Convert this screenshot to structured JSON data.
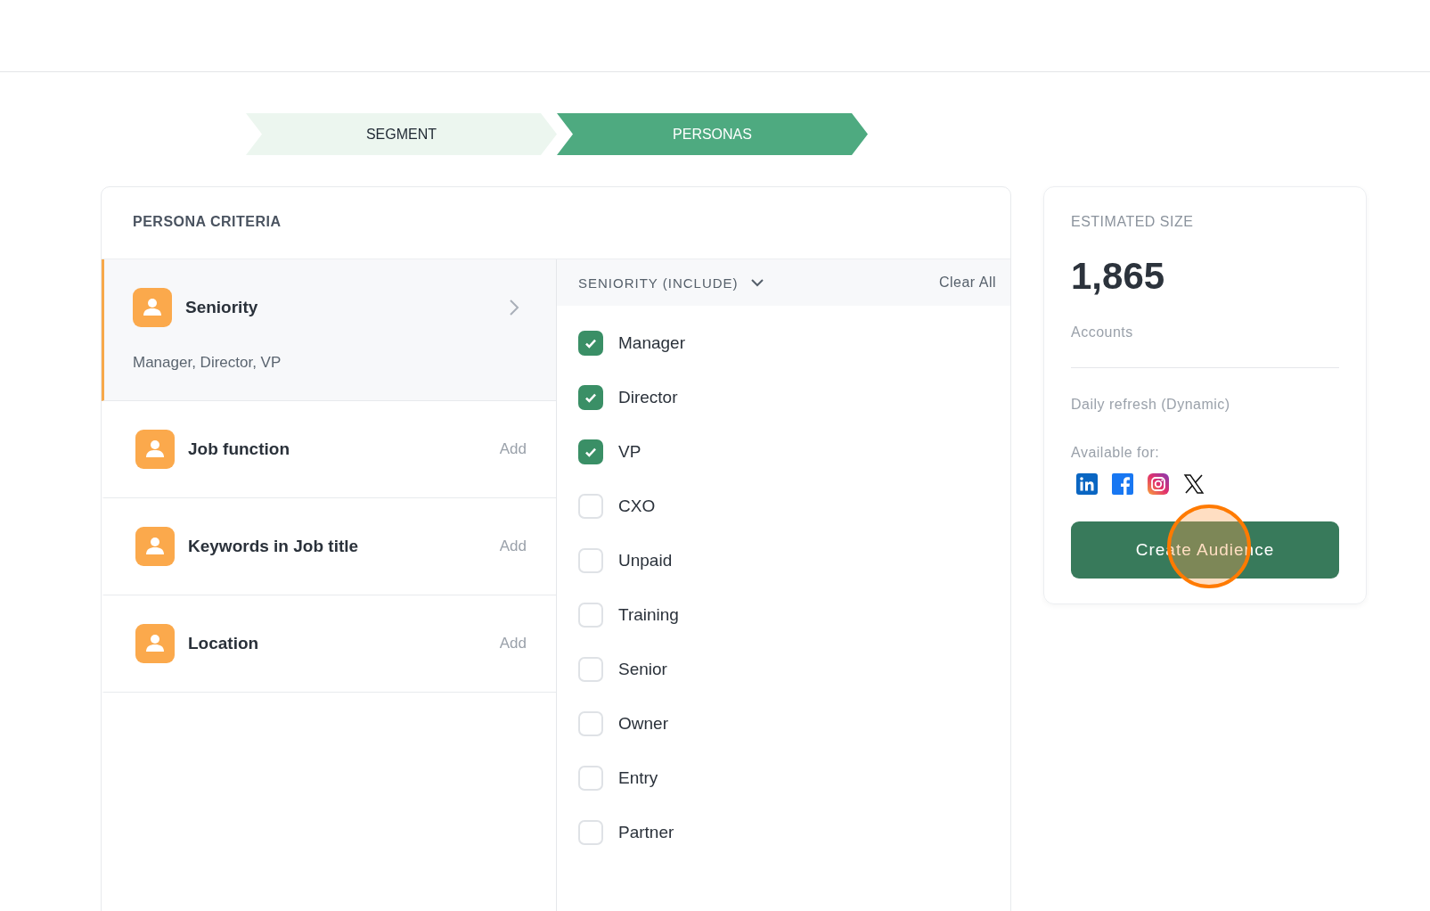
{
  "steps": [
    {
      "label": "SEGMENT",
      "selected": false
    },
    {
      "label": "PERSONAS",
      "selected": true
    }
  ],
  "criteria": {
    "title": "PERSONA CRITERIA",
    "items": [
      {
        "label": "Seniority",
        "selected": true,
        "summary": "Manager, Director, VP"
      },
      {
        "label": "Job function",
        "selected": false,
        "action": "Add"
      },
      {
        "label": "Keywords in Job title",
        "selected": false,
        "action": "Add"
      },
      {
        "label": "Location",
        "selected": false,
        "action": "Add"
      }
    ]
  },
  "options_panel": {
    "title": "SENIORITY (INCLUDE)",
    "clear_label": "Clear All",
    "options": [
      {
        "label": "Manager",
        "checked": true
      },
      {
        "label": "Director",
        "checked": true
      },
      {
        "label": "VP",
        "checked": true
      },
      {
        "label": "CXO",
        "checked": false
      },
      {
        "label": "Unpaid",
        "checked": false
      },
      {
        "label": "Training",
        "checked": false
      },
      {
        "label": "Senior",
        "checked": false
      },
      {
        "label": "Owner",
        "checked": false
      },
      {
        "label": "Entry",
        "checked": false
      },
      {
        "label": "Partner",
        "checked": false
      }
    ]
  },
  "estimate": {
    "title": "ESTIMATED SIZE",
    "value": "1,865",
    "unit": "Accounts",
    "refresh": "Daily refresh (Dynamic)",
    "available_label": "Available for:",
    "button": "Create Audience"
  }
}
